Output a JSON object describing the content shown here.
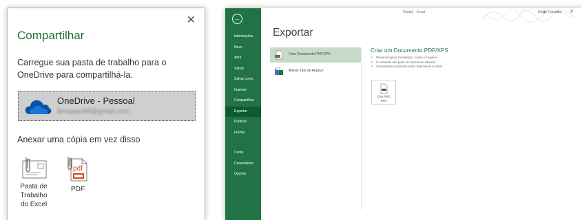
{
  "share_pane": {
    "title": "Compartilhar",
    "close_glyph": "✕",
    "description": "Carregue sua pasta de trabalho para o OneDrive para compartilhá-la.",
    "onedrive": {
      "name": "OneDrive - Pessoal",
      "email": "lkmaaqo89@gmail.com",
      "icon": "onedrive-cloud-icon"
    },
    "attach_heading": "Anexar uma cópia em vez disso",
    "attachments": [
      {
        "label_lines": [
          "Pasta de",
          "Trabalho",
          "do Excel"
        ],
        "icon": "excel-attachment-icon"
      },
      {
        "label": "PDF",
        "icon": "pdf-attachment-icon",
        "icon_text": "pdf"
      }
    ]
  },
  "backstage": {
    "back_glyph": "←",
    "doc_title": "Pasta1 - Excel",
    "user": "Diego Carvalho",
    "window_controls": "? — ✕",
    "accent_color": "#217346",
    "nav": [
      {
        "label": "Informações"
      },
      {
        "label": "Novo"
      },
      {
        "label": "Abrir"
      },
      {
        "label": "Salvar"
      },
      {
        "label": "Salvar como"
      },
      {
        "label": "Imprimir"
      },
      {
        "label": "Compartilhar"
      },
      {
        "label": "Exportar",
        "active": true
      },
      {
        "label": "Publicar"
      },
      {
        "label": "Fechar"
      },
      {
        "label": "Conta"
      },
      {
        "label": "Comentários"
      },
      {
        "label": "Opções"
      }
    ],
    "heading": "Exportar",
    "options": [
      {
        "label": "Criar Documento PDF/XPS",
        "selected": true,
        "icon": "pdf-document-icon"
      },
      {
        "label": "Alterar Tipo de Arquivo",
        "selected": false,
        "icon": "change-file-type-icon"
      }
    ],
    "detail": {
      "title": "Criar um Documento PDF/XPS",
      "bullets": [
        "Preserva layout, formatação, fontes e imagens",
        "O conteúdo não pode ser facilmente alterado",
        "Visualizadores gratuitos estão disponíveis na Web"
      ],
      "button_lines": [
        "Criar PDF/",
        "XPS"
      ],
      "button_icon": "create-pdf-xps-icon"
    }
  }
}
